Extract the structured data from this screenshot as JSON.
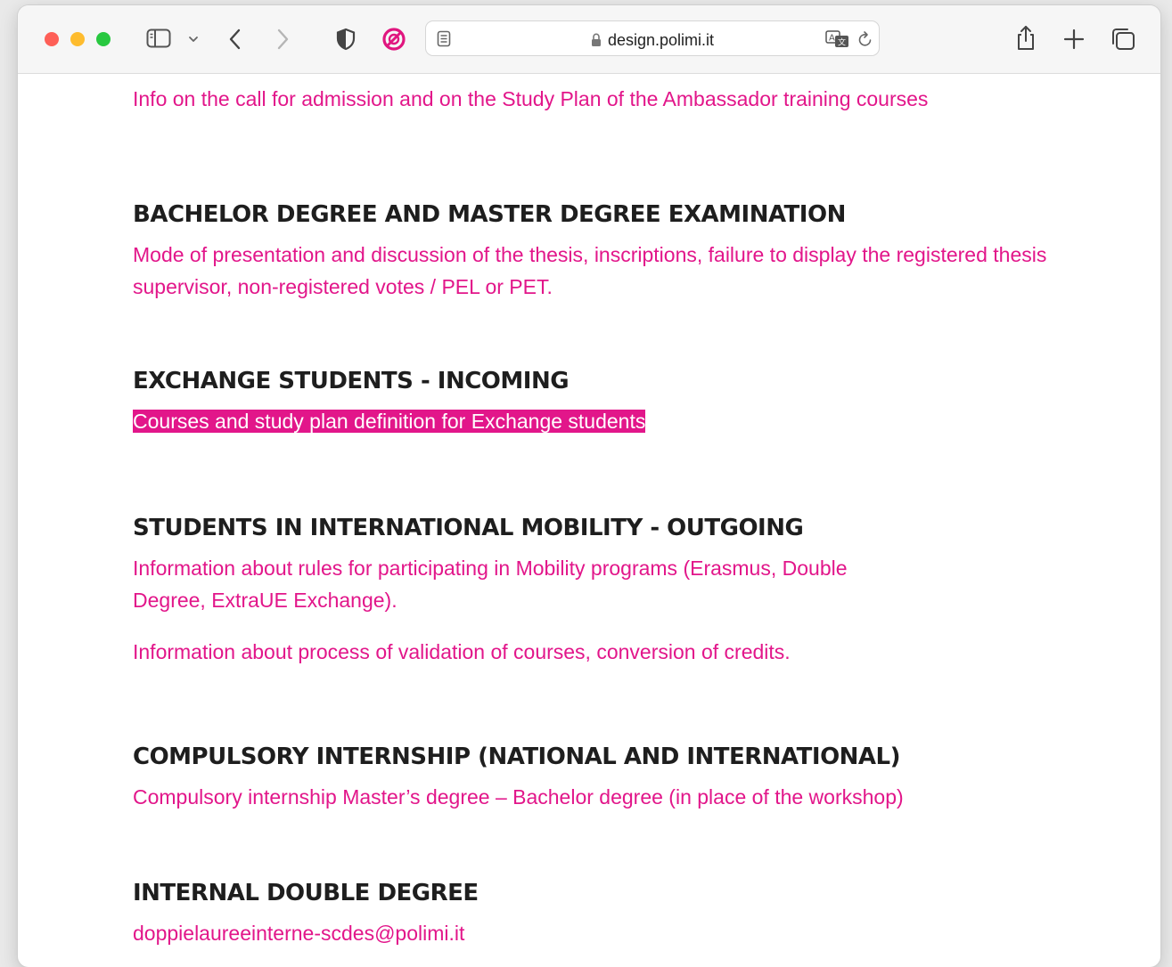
{
  "browser": {
    "url": "design.polimi.it"
  },
  "page": {
    "top_link": "Info on the call for admission and on the Study Plan of the Ambassador training courses",
    "sections": [
      {
        "heading": "BACHELOR DEGREE AND MASTER DEGREE EXAMINATION",
        "links": [
          "Mode of presentation and discussion of the thesis, inscriptions, failure to display the registered thesis supervisor, non-registered votes / PEL or PET."
        ]
      },
      {
        "heading": "EXCHANGE STUDENTS  - INCOMING",
        "links": [
          "Courses and study plan definition for Exchange students"
        ]
      },
      {
        "heading": "STUDENTS IN INTERNATIONAL MOBILITY - OUTGOING",
        "links": [
          "Information about rules for participating in Mobility programs (Erasmus, Double Degree, ExtraUE Exchange).",
          "Information about process of validation of courses, conversion of credits."
        ]
      },
      {
        "heading": "COMPULSORY INTERNSHIP (NATIONAL AND INTERNATIONAL)",
        "links": [
          "Compulsory internship Master’s degree – Bachelor degree (in place of the workshop)"
        ]
      },
      {
        "heading": "INTERNAL DOUBLE DEGREE",
        "links": [
          "doppielaureeinterne-scdes@polimi.it"
        ]
      }
    ]
  },
  "icons": {
    "sidebar": "sidebar-icon",
    "sidebar_menu": "chevron-down-icon",
    "back": "chevron-left-icon",
    "forward": "chevron-right-icon",
    "shield": "shield-icon",
    "blocker": "block-icon",
    "reader": "reader-icon",
    "lock": "lock-icon",
    "translate": "translate-icon",
    "reload": "reload-icon",
    "share": "share-icon",
    "new_tab": "plus-icon",
    "tabs": "tabs-overview-icon"
  },
  "colors": {
    "link": "#e2168a",
    "heading": "#1e1e1e",
    "highlight_bg": "#e2168a",
    "highlight_text": "#ffffff"
  }
}
